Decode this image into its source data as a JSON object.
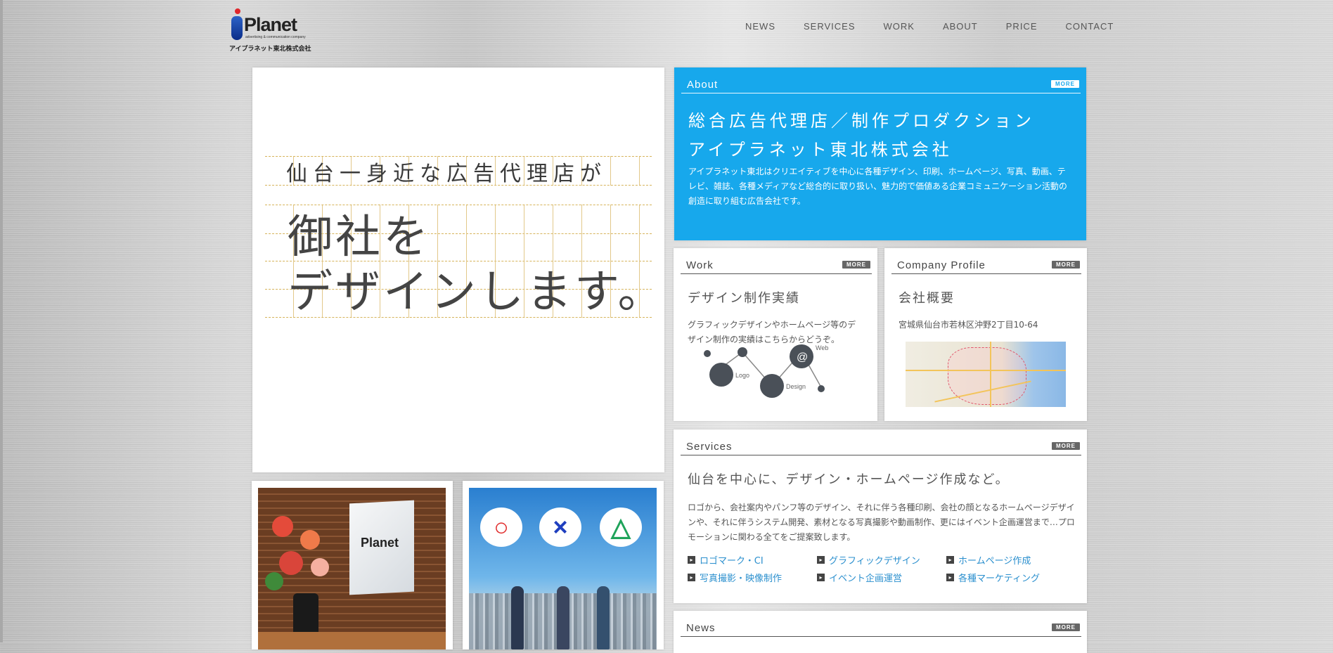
{
  "header": {
    "logo_word": "Planet",
    "logo_tagline": "advertising & communication company",
    "logo_company": "アイプラネット東北株式会社",
    "nav": [
      "NEWS",
      "SERVICES",
      "WORK",
      "ABOUT",
      "PRICE",
      "CONTACT"
    ]
  },
  "hero": {
    "line1": "仙台一身近な広告代理店が",
    "line2a": "御社を",
    "line2b": "デザインします。"
  },
  "photos": {
    "sign_logo": "Planet",
    "bubbles": [
      "○",
      "×",
      "△"
    ]
  },
  "more_label": "MORE",
  "about": {
    "heading": "About",
    "catch1": "総合広告代理店／制作プロダクション",
    "catch2": "アイプラネット東北株式会社",
    "text": "アイプラネット東北はクリエイティブを中心に各種デザイン、印刷、ホームページ、写真、動画、テレビ、雑誌、各種メディアなど総合的に取り扱い、魅力的で価値ある企業コミュニケーション活動の創造に取り組む広告会社です。"
  },
  "work": {
    "heading": "Work",
    "title": "デザイン制作実績",
    "text": "グラフィックデザインやホームページ等のデザイン制作の実績はこちらからどうぞ。",
    "diagram_labels": [
      "Logo",
      "Design",
      "Web"
    ]
  },
  "profile": {
    "heading": "Company Profile",
    "title": "会社概要",
    "address": "宮城県仙台市若林区沖野2丁目10-64"
  },
  "services": {
    "heading": "Services",
    "title": "仙台を中心に、デザイン・ホームページ作成など。",
    "text": "ロゴから、会社案内やパンフ等のデザイン、それに伴う各種印刷、会社の顔となるホームページデザインや、それに伴うシステム開発、素材となる写真撮影や動画制作、更にはイベント企画運営まで…プロモーションに関わる全てをご提案致します。",
    "items": [
      "ロゴマーク・CI",
      "グラフィックデザイン",
      "ホームページ作成",
      "写真撮影・映像制作",
      "イベント企画運営",
      "各種マーケティング"
    ]
  },
  "news": {
    "heading": "News"
  },
  "colors": {
    "accent": "#17a8ec",
    "link": "#2a8fce",
    "grid_line": "#d6b35a"
  }
}
